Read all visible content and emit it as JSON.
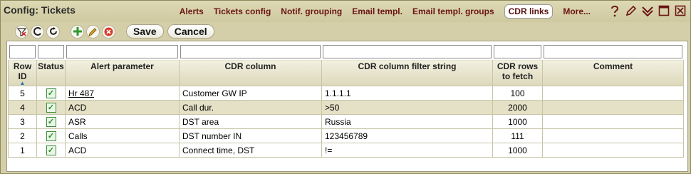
{
  "window": {
    "title": "Config: Tickets"
  },
  "tabs": [
    {
      "label": "Alerts",
      "active": false
    },
    {
      "label": "Tickets config",
      "active": false
    },
    {
      "label": "Notif. grouping",
      "active": false
    },
    {
      "label": "Email templ.",
      "active": false
    },
    {
      "label": "Email templ. groups",
      "active": false
    },
    {
      "label": "CDR links",
      "active": true
    },
    {
      "label": "More...",
      "active": false
    }
  ],
  "toolbar": {
    "save_label": "Save",
    "cancel_label": "Cancel"
  },
  "table": {
    "columns": [
      {
        "key": "row_id",
        "label": "Row ID"
      },
      {
        "key": "status",
        "label": "Status"
      },
      {
        "key": "alert_parameter",
        "label": "Alert parameter"
      },
      {
        "key": "cdr_column",
        "label": "CDR column"
      },
      {
        "key": "cdr_filter",
        "label": "CDR column filter string"
      },
      {
        "key": "cdr_rows",
        "label": "CDR rows to fetch"
      },
      {
        "key": "comment",
        "label": "Comment"
      }
    ],
    "rows": [
      {
        "row_id": "5",
        "status": "checked",
        "alert_parameter": "Hr 487",
        "cdr_column": "Customer GW IP",
        "cdr_filter": "1.1.1.1",
        "cdr_rows": "100",
        "comment": ""
      },
      {
        "row_id": "4",
        "status": "checked",
        "alert_parameter": "ACD",
        "cdr_column": "Call dur.",
        "cdr_filter": ">50",
        "cdr_rows": "2000",
        "comment": ""
      },
      {
        "row_id": "3",
        "status": "checked",
        "alert_parameter": "ASR",
        "cdr_column": "DST area",
        "cdr_filter": "Russia",
        "cdr_rows": "1000",
        "comment": ""
      },
      {
        "row_id": "2",
        "status": "checked",
        "alert_parameter": "Calls",
        "cdr_column": "DST number IN",
        "cdr_filter": "123456789",
        "cdr_rows": "111",
        "comment": ""
      },
      {
        "row_id": "1",
        "status": "checked",
        "alert_parameter": "ACD",
        "cdr_column": "Connect time, DST",
        "cdr_filter": "!=",
        "cdr_rows": "1000",
        "comment": ""
      }
    ]
  },
  "colors": {
    "tab_text": "#6b1414",
    "window_bg": "#d4cfa8",
    "alt_row": "#e4e1c6",
    "check_green": "#2f8a2f"
  }
}
